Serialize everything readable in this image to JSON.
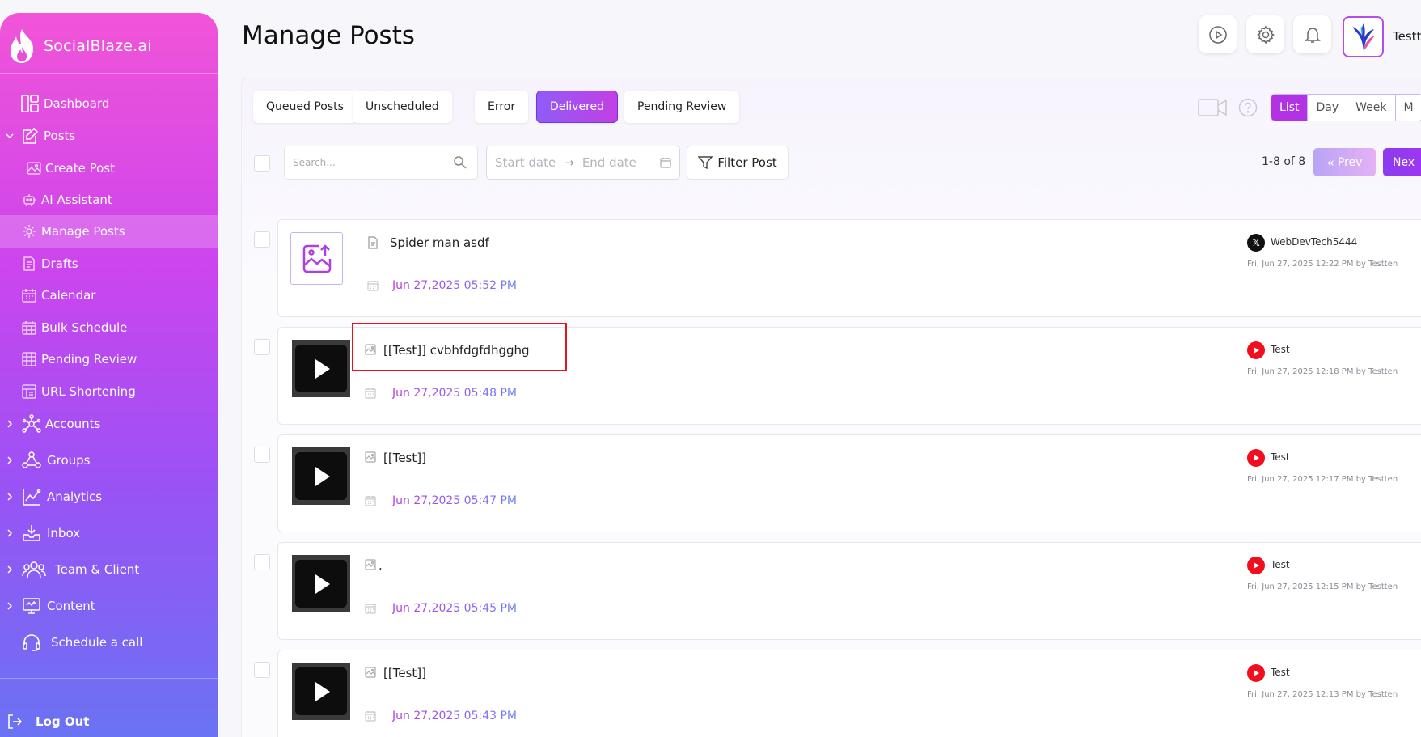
{
  "app": {
    "brand": "SocialBlaze.ai"
  },
  "sidebar": {
    "items": [
      {
        "label": "Dashboard",
        "icon": "dashboard-icon"
      },
      {
        "label": "Posts",
        "icon": "edit-post-icon",
        "expanded": true
      },
      {
        "label": "Create Post",
        "icon": "image-edit-icon"
      },
      {
        "label": "AI Assistant",
        "icon": "robot-icon"
      },
      {
        "label": "Manage Posts",
        "icon": "gear-cog-icon",
        "active": true
      },
      {
        "label": "Drafts",
        "icon": "draft-doc-icon"
      },
      {
        "label": "Calendar",
        "icon": "calendar-icon"
      },
      {
        "label": "Bulk Schedule",
        "icon": "calendar-grid-icon"
      },
      {
        "label": "Pending Review",
        "icon": "review-grid-icon"
      },
      {
        "label": "URL Shortening",
        "icon": "link-icon"
      },
      {
        "label": "Accounts",
        "icon": "network-icon"
      },
      {
        "label": "Groups",
        "icon": "groups-icon"
      },
      {
        "label": "Analytics",
        "icon": "chart-icon"
      },
      {
        "label": "Inbox",
        "icon": "inbox-icon"
      },
      {
        "label": "Team & Client",
        "icon": "team-icon"
      },
      {
        "label": "Content",
        "icon": "content-icon"
      },
      {
        "label": "Schedule a call",
        "icon": "headset-icon"
      }
    ],
    "logout": "Log Out"
  },
  "header": {
    "title": "Manage Posts",
    "user_name": "Testt"
  },
  "tabs": [
    {
      "label": "Queued Posts"
    },
    {
      "label": "Unscheduled"
    },
    {
      "label": "Error"
    },
    {
      "label": "Delivered",
      "active": true
    },
    {
      "label": "Pending Review"
    }
  ],
  "view_modes": [
    {
      "label": "List",
      "active": true
    },
    {
      "label": "Day"
    },
    {
      "label": "Week"
    },
    {
      "label": "M"
    }
  ],
  "filters": {
    "search_placeholder": "Search...",
    "start_date_placeholder": "Start date",
    "end_date_placeholder": "End date",
    "date_separator": "→",
    "filter_label": "Filter Post"
  },
  "pagination": {
    "range_text": "1-8 of 8",
    "prev_label": "Prev",
    "next_label": "Nex"
  },
  "posts": [
    {
      "title": "Spider man asdf",
      "date": "Jun 27,2025 05:52 PM",
      "account": "WebDevTech5444",
      "platform": "x",
      "meta": "Fri, Jun 27, 2025 12:22 PM by Testten",
      "thumb": "image-placeholder"
    },
    {
      "title": "[[Test]] cvbhfdgfdhgghg",
      "date": "Jun 27,2025 05:48 PM",
      "account": "Test",
      "platform": "youtube",
      "meta": "Fri, Jun 27, 2025 12:18 PM by Testten",
      "thumb": "video"
    },
    {
      "title": "[[Test]]",
      "date": "Jun 27,2025 05:47 PM",
      "account": "Test",
      "platform": "youtube",
      "meta": "Fri, Jun 27, 2025 12:17 PM by Testten",
      "thumb": "video"
    },
    {
      "title": ".",
      "date": "Jun 27,2025 05:45 PM",
      "account": "Test",
      "platform": "youtube",
      "meta": "Fri, Jun 27, 2025 12:15 PM by Testten",
      "thumb": "video"
    },
    {
      "title": "[[Test]]",
      "date": "Jun 27,2025 05:43 PM",
      "account": "Test",
      "platform": "youtube",
      "meta": "Fri, Jun 27, 2025 12:13 PM by Testten",
      "thumb": "video"
    }
  ],
  "colors": {
    "accent": "#b233e3",
    "youtube": "#f00f1e",
    "highlight": "#e8141c"
  }
}
